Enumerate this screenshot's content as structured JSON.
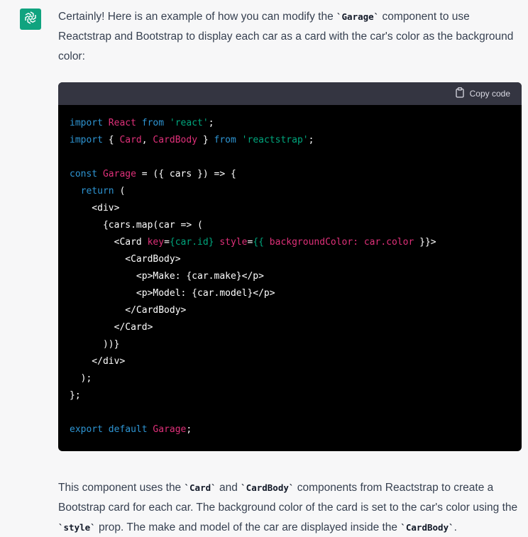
{
  "intro": {
    "part1": "Certainly! Here is an example of how you can modify the ",
    "code1": "`Garage`",
    "part2": " component to use Reactstrap and Bootstrap to display each car as a card with the car's color as the background color:"
  },
  "code_block": {
    "copy_label": "Copy code",
    "lines": [
      [
        {
          "t": "import",
          "c": "kw"
        },
        {
          "t": " ",
          "c": "plain"
        },
        {
          "t": "React",
          "c": "id"
        },
        {
          "t": " ",
          "c": "plain"
        },
        {
          "t": "from",
          "c": "kw"
        },
        {
          "t": " ",
          "c": "plain"
        },
        {
          "t": "'react'",
          "c": "str"
        },
        {
          "t": ";",
          "c": "plain"
        }
      ],
      [
        {
          "t": "import",
          "c": "kw"
        },
        {
          "t": " { ",
          "c": "plain"
        },
        {
          "t": "Card",
          "c": "id"
        },
        {
          "t": ", ",
          "c": "plain"
        },
        {
          "t": "CardBody",
          "c": "id"
        },
        {
          "t": " } ",
          "c": "plain"
        },
        {
          "t": "from",
          "c": "kw"
        },
        {
          "t": " ",
          "c": "plain"
        },
        {
          "t": "'reactstrap'",
          "c": "str"
        },
        {
          "t": ";",
          "c": "plain"
        }
      ],
      [],
      [
        {
          "t": "const",
          "c": "kw"
        },
        {
          "t": " ",
          "c": "plain"
        },
        {
          "t": "Garage",
          "c": "id"
        },
        {
          "t": " = ({ cars }) => {",
          "c": "plain"
        }
      ],
      [
        {
          "t": "  ",
          "c": "plain"
        },
        {
          "t": "return",
          "c": "kw"
        },
        {
          "t": " (",
          "c": "plain"
        }
      ],
      [
        {
          "t": "    <div>",
          "c": "tag"
        }
      ],
      [
        {
          "t": "      {cars.map(car => (",
          "c": "plain"
        }
      ],
      [
        {
          "t": "        <Card ",
          "c": "tag"
        },
        {
          "t": "key",
          "c": "attr"
        },
        {
          "t": "=",
          "c": "plain"
        },
        {
          "t": "{car.id}",
          "c": "attrval"
        },
        {
          "t": " ",
          "c": "plain"
        },
        {
          "t": "style",
          "c": "attr"
        },
        {
          "t": "=",
          "c": "plain"
        },
        {
          "t": "{{",
          "c": "attrval"
        },
        {
          "t": " ",
          "c": "plain"
        },
        {
          "t": "backgroundColor: car.color",
          "c": "attr"
        },
        {
          "t": " }}>",
          "c": "plain"
        }
      ],
      [
        {
          "t": "          <CardBody>",
          "c": "tag"
        }
      ],
      [
        {
          "t": "            <p>Make: {car.make}</p>",
          "c": "tag"
        }
      ],
      [
        {
          "t": "            <p>Model: {car.model}</p>",
          "c": "tag"
        }
      ],
      [
        {
          "t": "          </CardBody>",
          "c": "tag"
        }
      ],
      [
        {
          "t": "        </Card>",
          "c": "tag"
        }
      ],
      [
        {
          "t": "      ))}",
          "c": "plain"
        }
      ],
      [
        {
          "t": "    </div>",
          "c": "tag"
        }
      ],
      [
        {
          "t": "  );",
          "c": "plain"
        }
      ],
      [
        {
          "t": "};",
          "c": "plain"
        }
      ],
      [],
      [
        {
          "t": "export",
          "c": "kw"
        },
        {
          "t": " ",
          "c": "plain"
        },
        {
          "t": "default",
          "c": "kw"
        },
        {
          "t": " ",
          "c": "plain"
        },
        {
          "t": "Garage",
          "c": "id"
        },
        {
          "t": ";",
          "c": "plain"
        }
      ]
    ]
  },
  "outro": {
    "part1": "This component uses the ",
    "code1": "`Card`",
    "part2": " and ",
    "code2": "`CardBody`",
    "part3": " components from Reactstrap to create a Bootstrap card for each car. The background color of the card is set to the car's color using the ",
    "code3": "`style`",
    "part4": " prop. The make and model of the car are displayed inside the ",
    "code4": "`CardBody`",
    "part5": "."
  },
  "colors": {
    "avatar_bg": "#10a37f",
    "code_bg": "#000000",
    "code_header_bg": "#343541",
    "keyword": "#2e95d3",
    "identifier": "#df3079",
    "string": "#00a67d"
  },
  "icons": {
    "avatar": "openai-logo-icon",
    "copy": "clipboard-icon"
  }
}
